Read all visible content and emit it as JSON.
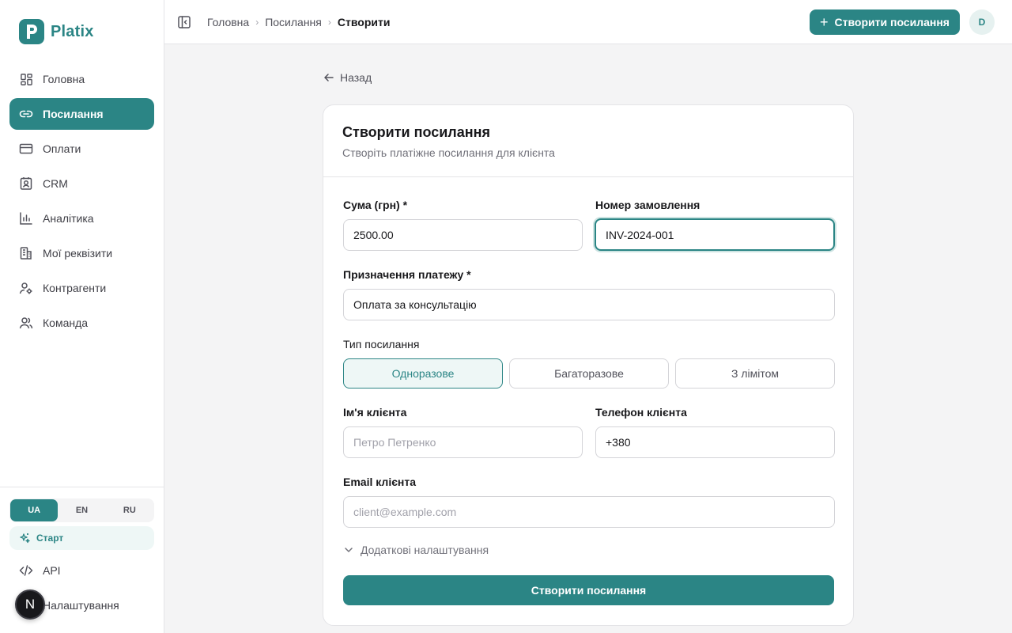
{
  "app": {
    "name": "Platix",
    "accent": "#2b8585"
  },
  "sidebar": {
    "items": [
      {
        "label": "Головна",
        "icon": "dashboard-icon"
      },
      {
        "label": "Посилання",
        "icon": "link-icon",
        "active": true
      },
      {
        "label": "Оплати",
        "icon": "credit-card-icon"
      },
      {
        "label": "CRM",
        "icon": "contact-icon"
      },
      {
        "label": "Аналітика",
        "icon": "bar-chart-icon"
      },
      {
        "label": "Мої реквізити",
        "icon": "building-icon"
      },
      {
        "label": "Контрагенти",
        "icon": "user-settings-icon"
      },
      {
        "label": "Команда",
        "icon": "users-icon"
      }
    ],
    "languages": [
      "UA",
      "EN",
      "RU"
    ],
    "active_language": "UA",
    "start_label": "Старт",
    "api_label": "API",
    "settings_label": "Налаштування",
    "badge_letter": "N"
  },
  "header": {
    "breadcrumbs": [
      "Головна",
      "Посилання",
      "Створити"
    ],
    "create_button": "Створити посилання",
    "avatar_initial": "D"
  },
  "page": {
    "back_label": "Назад",
    "card": {
      "title": "Створити посилання",
      "subtitle": "Створіть платіжне посилання для клієнта"
    },
    "form": {
      "amount": {
        "label": "Сума (грн) *",
        "value": "2500.00"
      },
      "order_number": {
        "label": "Номер замовлення",
        "value": "INV-2024-001"
      },
      "purpose": {
        "label": "Призначення платежу *",
        "value": "Оплата за консультацію"
      },
      "link_type": {
        "label": "Тип посилання",
        "options": [
          "Одноразове",
          "Багаторазове",
          "З лімітом"
        ],
        "selected": "Одноразове"
      },
      "client_name": {
        "label": "Ім'я клієнта",
        "placeholder": "Петро Петренко",
        "value": ""
      },
      "client_phone": {
        "label": "Телефон клієнта",
        "value": "+380"
      },
      "client_email": {
        "label": "Email клієнта",
        "placeholder": "client@example.com",
        "value": ""
      },
      "advanced_label": "Додаткові налаштування",
      "submit_label": "Створити посилання"
    }
  }
}
